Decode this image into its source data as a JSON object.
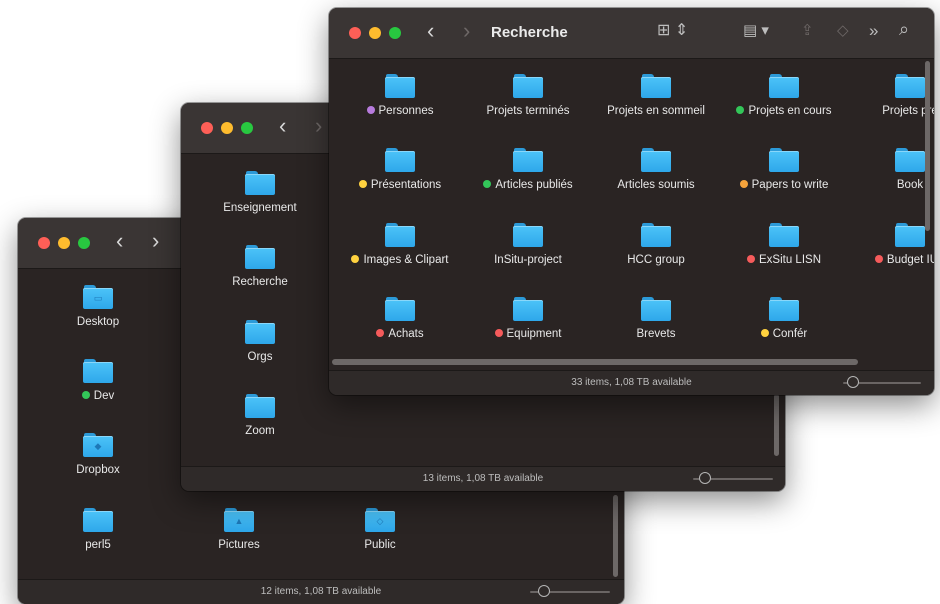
{
  "colors": {
    "window_bg": "#2a2423",
    "titlebar_bg": "#3a3534",
    "folder_blue": "#3fb6f4",
    "tag_purple": "#b77bdd",
    "tag_green": "#33c659",
    "tag_yellow": "#ffd23f",
    "tag_orange": "#f5a33b",
    "tag_red": "#f55b5b"
  },
  "window_back": {
    "nav": {
      "back_icon": "chevron-left-icon",
      "forward_icon": "chevron-right-icon"
    },
    "items": [
      {
        "label": "Desktop",
        "tag": null,
        "icon": "desktop-folder-icon"
      },
      {
        "label": "Dev",
        "tag": "green",
        "icon": "folder-icon"
      },
      {
        "label": "Dropbox",
        "tag": null,
        "icon": "dropbox-folder-icon"
      },
      {
        "label": "perl5",
        "tag": null,
        "icon": "folder-icon"
      },
      {
        "label": "Pictures",
        "tag": null,
        "icon": "pictures-folder-icon"
      },
      {
        "label": "Public",
        "tag": null,
        "icon": "public-folder-icon"
      }
    ],
    "status": "12 items, 1,08 TB available"
  },
  "window_middle": {
    "nav": {
      "back_icon": "chevron-left-icon",
      "forward_icon": "chevron-right-icon"
    },
    "items": [
      {
        "label": "Enseignement",
        "tag": null,
        "icon": "folder-icon"
      },
      {
        "label": "Recherche",
        "tag": null,
        "icon": "folder-icon"
      },
      {
        "label": "Orgs",
        "tag": null,
        "icon": "folder-icon"
      },
      {
        "label": "Zoom",
        "tag": null,
        "icon": "folder-icon"
      }
    ],
    "status": "13 items, 1,08 TB available"
  },
  "window_front": {
    "title": "Recherche",
    "toolbar": {
      "view_icon": "grid-view-icon",
      "group_icon": "group-by-icon",
      "share_icon": "share-icon",
      "tag_icon": "tag-icon",
      "more_icon": "double-chevron-right-icon",
      "search_icon": "search-icon"
    },
    "items": [
      {
        "label": "Personnes",
        "tag": "purple"
      },
      {
        "label": "Projets terminés",
        "tag": null
      },
      {
        "label": "Projets en sommeil",
        "tag": null
      },
      {
        "label": "Projets en cours",
        "tag": "green"
      },
      {
        "label": "Projets pre",
        "tag": null
      },
      {
        "label": "Présentations",
        "tag": "yellow"
      },
      {
        "label": "Articles publiés",
        "tag": "green"
      },
      {
        "label": "Articles soumis",
        "tag": null
      },
      {
        "label": "Papers to write",
        "tag": "orange"
      },
      {
        "label": "Book",
        "tag": null
      },
      {
        "label": "Images & Clipart",
        "tag": "yellow"
      },
      {
        "label": "InSitu-project",
        "tag": null
      },
      {
        "label": "HCC group",
        "tag": null
      },
      {
        "label": "ExSitu LISN",
        "tag": "red"
      },
      {
        "label": "Budget IUF",
        "tag": "red"
      },
      {
        "label": "Achats",
        "tag": "red"
      },
      {
        "label": "Equipment",
        "tag": "red"
      },
      {
        "label": "Brevets",
        "tag": null
      },
      {
        "label": "Confér",
        "tag": "yellow"
      }
    ],
    "status": "33 items, 1,08 TB available"
  }
}
